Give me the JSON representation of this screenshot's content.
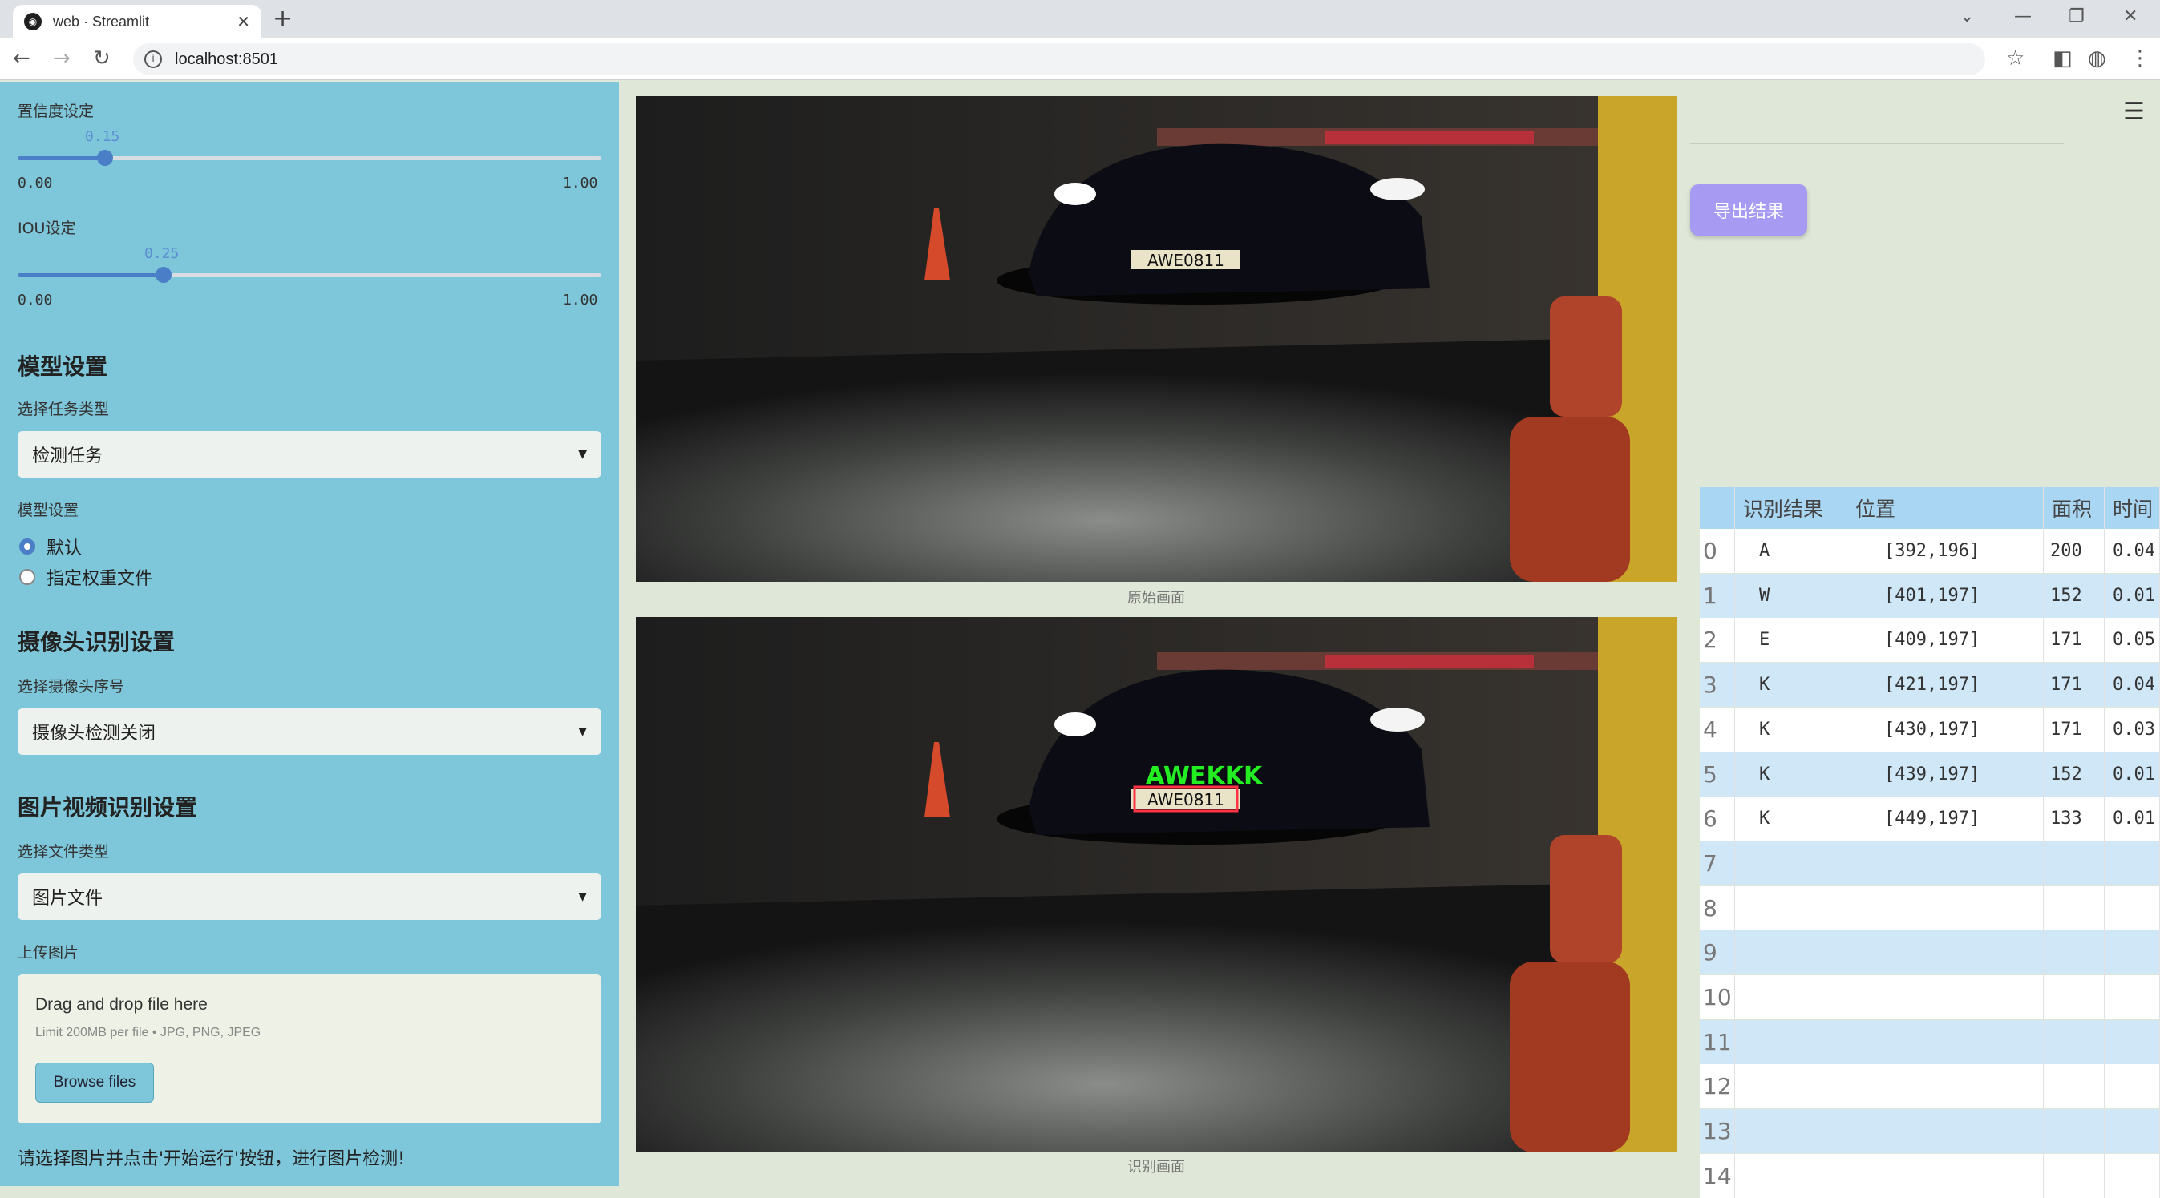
{
  "browser": {
    "tab_title": "web · Streamlit",
    "url": "localhost:8501"
  },
  "sidebar": {
    "conf_label": "置信度设定",
    "conf_value": "0.15",
    "conf_value_num": 0.15,
    "conf_min": "0.00",
    "conf_max": "1.00",
    "iou_label": "IOU设定",
    "iou_value": "0.25",
    "iou_value_num": 0.25,
    "iou_min": "0.00",
    "iou_max": "1.00",
    "model_heading": "模型设置",
    "task_label": "选择任务类型",
    "task_value": "检测任务",
    "model_label": "模型设置",
    "radio_default": "默认",
    "radio_custom": "指定权重文件",
    "camera_heading": "摄像头识别设置",
    "camera_label": "选择摄像头序号",
    "camera_value": "摄像头检测关闭",
    "media_heading": "图片视频识别设置",
    "filetype_label": "选择文件类型",
    "filetype_value": "图片文件",
    "upload_label": "上传图片",
    "drop_text": "Drag and drop file here",
    "limit_text": "Limit 200MB per file • JPG, PNG, JPEG",
    "browse_label": "Browse files",
    "hint_text": "请选择图片并点击'开始运行'按钮，进行图片检测!"
  },
  "main": {
    "original_caption": "原始画面",
    "result_caption": "识别画面",
    "plate_text": "AWE0811",
    "detection_text": "AWEKKK"
  },
  "right": {
    "export_label": "导出结果",
    "table": {
      "headers": [
        "识别结果",
        "位置",
        "面积",
        "时间"
      ],
      "rows": [
        {
          "idx": "0",
          "res": "A",
          "pos": "[392,196]",
          "area": "200",
          "time": "0.04"
        },
        {
          "idx": "1",
          "res": "W",
          "pos": "[401,197]",
          "area": "152",
          "time": "0.01"
        },
        {
          "idx": "2",
          "res": "E",
          "pos": "[409,197]",
          "area": "171",
          "time": "0.05"
        },
        {
          "idx": "3",
          "res": "K",
          "pos": "[421,197]",
          "area": "171",
          "time": "0.04"
        },
        {
          "idx": "4",
          "res": "K",
          "pos": "[430,197]",
          "area": "171",
          "time": "0.03"
        },
        {
          "idx": "5",
          "res": "K",
          "pos": "[439,197]",
          "area": "152",
          "time": "0.01"
        },
        {
          "idx": "6",
          "res": "K",
          "pos": "[449,197]",
          "area": "133",
          "time": "0.01"
        },
        {
          "idx": "7",
          "res": "",
          "pos": "",
          "area": "",
          "time": ""
        },
        {
          "idx": "8",
          "res": "",
          "pos": "",
          "area": "",
          "time": ""
        },
        {
          "idx": "9",
          "res": "",
          "pos": "",
          "area": "",
          "time": ""
        },
        {
          "idx": "10",
          "res": "",
          "pos": "",
          "area": "",
          "time": ""
        },
        {
          "idx": "11",
          "res": "",
          "pos": "",
          "area": "",
          "time": ""
        },
        {
          "idx": "12",
          "res": "",
          "pos": "",
          "area": "",
          "time": ""
        },
        {
          "idx": "13",
          "res": "",
          "pos": "",
          "area": "",
          "time": ""
        },
        {
          "idx": "14",
          "res": "",
          "pos": "",
          "area": "",
          "time": ""
        }
      ]
    }
  },
  "colors": {
    "sidebar_bg": "#7ec6d9",
    "accent": "#4a7ec7",
    "export_btn": "#a79af2",
    "row_alt": "#cfe7f7",
    "header_bg": "#a9d6f3",
    "detection_green": "#22ee22",
    "plate_box_red": "#ff3344"
  }
}
